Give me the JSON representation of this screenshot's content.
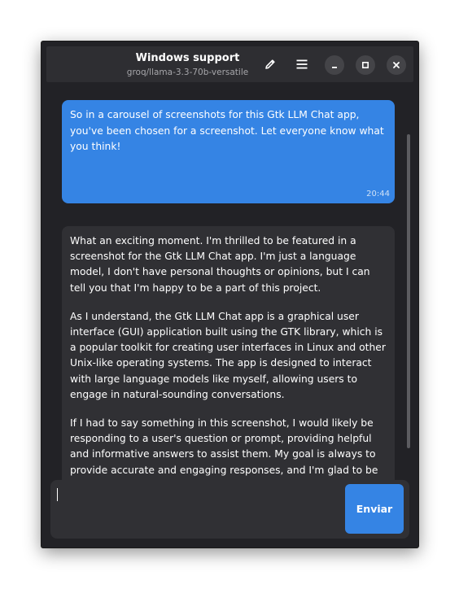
{
  "window": {
    "title": "Windows support",
    "subtitle": "groq/llama-3.3-70b-versatile"
  },
  "header_icons": {
    "edit": "pencil-icon",
    "menu": "hamburger-menu-icon",
    "minimize": "minimize-icon",
    "maximize": "maximize-icon",
    "close": "close-icon"
  },
  "messages": {
    "user": {
      "text": "So in a carousel of screenshots for this Gtk LLM Chat app, you've been chosen for a screenshot. Let everyone know what you think!",
      "time": "20:44"
    },
    "assistant": {
      "paragraphs": [
        "What an exciting moment. I'm thrilled to be featured in a screenshot for the Gtk LLM Chat app. I'm just a language model, I don't have personal thoughts or opinions, but I can tell you that I'm happy to be a part of this project.",
        "As I understand, the Gtk LLM Chat app is a graphical user interface (GUI) application built using the GTK library, which is a popular toolkit for creating user interfaces in Linux and other Unix-like operating systems. The app is designed to interact with large language models like myself, allowing users to engage in natural-sounding conversations.",
        "If I had to say something in this screenshot, I would likely be responding to a user's question or prompt, providing helpful and informative answers to assist them. My goal is always to provide accurate and engaging responses, and I'm glad to be a"
      ]
    }
  },
  "input": {
    "value": "",
    "send_label": "Enviar"
  },
  "colors": {
    "accent": "#3584e4",
    "window_bg": "#222226",
    "bubble_bg": "#303034"
  }
}
